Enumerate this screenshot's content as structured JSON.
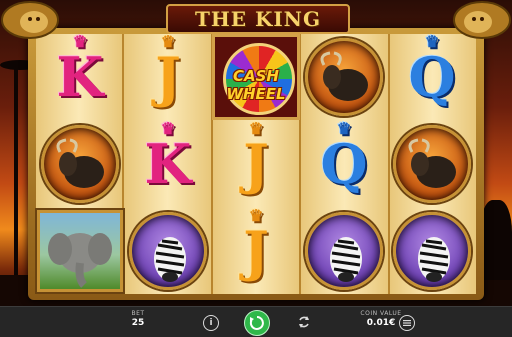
{
  "game": {
    "title": "THE KING",
    "reels": [
      [
        {
          "symbol": "K",
          "kind": "letter",
          "style": "k"
        },
        {
          "symbol": "wildebeest",
          "kind": "medal",
          "style": "gnu"
        },
        {
          "symbol": "elephant",
          "kind": "elephant"
        }
      ],
      [
        {
          "symbol": "J",
          "kind": "letter",
          "style": "j"
        },
        {
          "symbol": "K",
          "kind": "letter",
          "style": "k"
        },
        {
          "symbol": "zebra",
          "kind": "medal",
          "style": "zebra"
        }
      ],
      [
        {
          "symbol": "cash-wheel",
          "kind": "wheel",
          "text_top": "CASH",
          "text_bottom": "WHEEL"
        },
        {
          "symbol": "J",
          "kind": "letter",
          "style": "j"
        },
        {
          "symbol": "J",
          "kind": "letter",
          "style": "j"
        }
      ],
      [
        {
          "symbol": "wildebeest",
          "kind": "medal",
          "style": "gnu"
        },
        {
          "symbol": "Q",
          "kind": "letter",
          "style": "q"
        },
        {
          "symbol": "zebra",
          "kind": "medal",
          "style": "zebra"
        }
      ],
      [
        {
          "symbol": "Q",
          "kind": "letter",
          "style": "q"
        },
        {
          "symbol": "wildebeest",
          "kind": "medal",
          "style": "gnu"
        },
        {
          "symbol": "zebra",
          "kind": "medal",
          "style": "zebra"
        }
      ]
    ]
  },
  "bottom_bar": {
    "bet_label": "BET",
    "bet_value": "25",
    "coin_label": "COIN VALUE",
    "coin_value": "0.01€",
    "info_icon": "info-icon",
    "spin_icon": "spin-icon",
    "autoplay_icon": "autoplay-icon",
    "menu_icon": "menu-icon"
  },
  "colors": {
    "spin_button": "#2fb84a",
    "k_symbol": "#e2237f",
    "j_symbol": "#f7a21a",
    "q_symbol": "#2b7fe0",
    "frame_gold": "#c99a3a"
  }
}
